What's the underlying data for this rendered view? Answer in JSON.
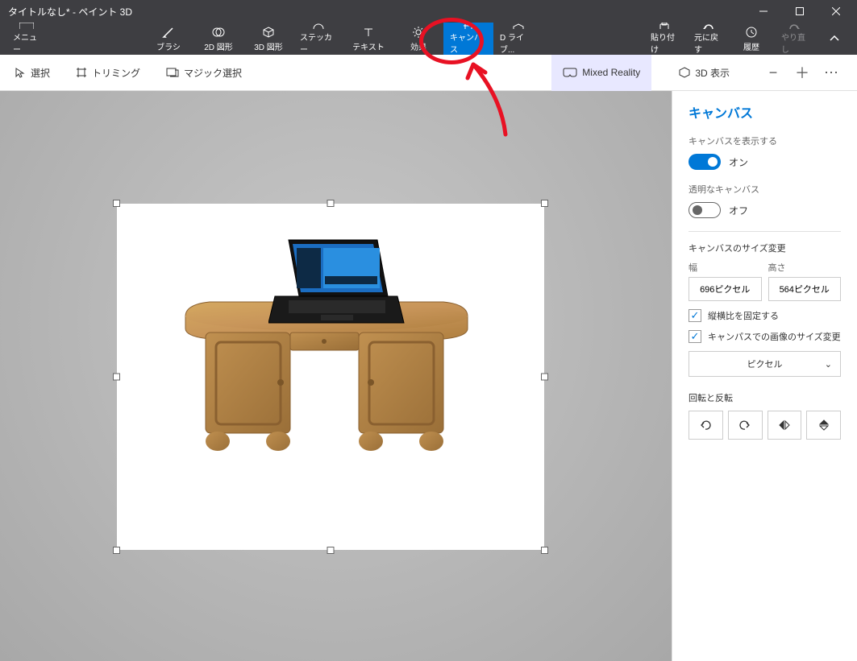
{
  "titlebar": {
    "title": "タイトルなし* - ペイント 3D"
  },
  "toolbar": {
    "menu": "メニュー",
    "items": [
      {
        "label": "ブラシ"
      },
      {
        "label": "2D 図形"
      },
      {
        "label": "3D 図形"
      },
      {
        "label": "ステッカー"
      },
      {
        "label": "テキスト"
      },
      {
        "label": "効果"
      },
      {
        "label": "キャンバス"
      },
      {
        "label": "D ライブ..."
      }
    ],
    "right": {
      "paste": "貼り付け",
      "undo": "元に戻す",
      "history": "履歴",
      "redo": "やり直し"
    }
  },
  "subtoolbar": {
    "select": "選択",
    "trim": "トリミング",
    "magic_select": "マジック選択",
    "mixed_reality": "Mixed Reality",
    "view3d": "3D 表示"
  },
  "panel": {
    "title": "キャンバス",
    "show_canvas": "キャンバスを表示する",
    "on": "オン",
    "transparent_canvas": "透明なキャンバス",
    "off": "オフ",
    "resize_section": "キャンバスのサイズ変更",
    "width_label": "幅",
    "height_label": "高さ",
    "width_value": "696ピクセル",
    "height_value": "564ピクセル",
    "lock_ratio": "縦横比を固定する",
    "resize_image": "キャンパスでの画像のサイズ変更",
    "unit": "ピクセル",
    "rotate_section": "回転と反転"
  }
}
